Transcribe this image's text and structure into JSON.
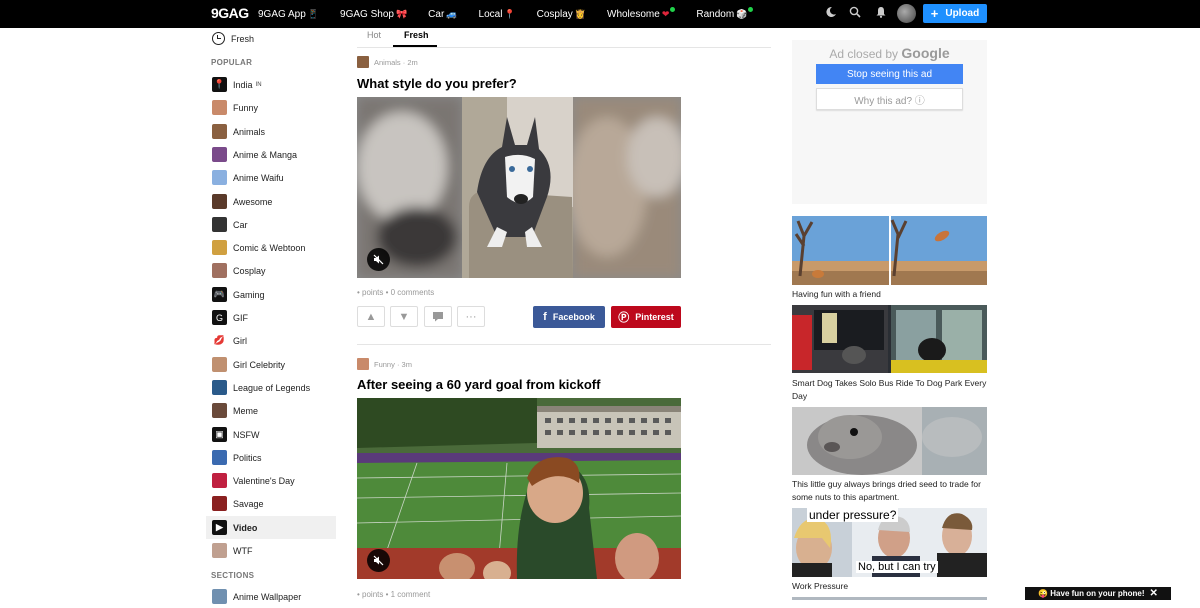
{
  "topbar": {
    "logo": "9GAG",
    "nav": [
      {
        "label": "9GAG App",
        "emoji": "📱",
        "dot": false
      },
      {
        "label": "9GAG Shop",
        "emoji": "🎀",
        "dot": false
      },
      {
        "label": "Car",
        "emoji": "🚙",
        "dot": false
      },
      {
        "label": "Local",
        "emoji": "📍",
        "dot": false
      },
      {
        "label": "Cosplay",
        "emoji": "👸",
        "dot": false
      },
      {
        "label": "Wholesome",
        "emoji": "❤",
        "dot": true
      },
      {
        "label": "Random",
        "emoji": "🎲",
        "dot": true
      }
    ],
    "upload_label": "Upload"
  },
  "sidebar": {
    "fresh_label": "Fresh",
    "popular_header": "POPULAR",
    "sections_header": "SECTIONS",
    "india_tag": "IN",
    "items": [
      {
        "label": "India",
        "color": "#111111",
        "glyph": "📍"
      },
      {
        "label": "Funny",
        "color": "#c98a6a",
        "glyph": ""
      },
      {
        "label": "Animals",
        "color": "#8a6040",
        "glyph": ""
      },
      {
        "label": "Anime & Manga",
        "color": "#7a4a8a",
        "glyph": ""
      },
      {
        "label": "Anime Waifu",
        "color": "#8ab0e0",
        "glyph": ""
      },
      {
        "label": "Awesome",
        "color": "#5a3a2a",
        "glyph": ""
      },
      {
        "label": "Car",
        "color": "#333333",
        "glyph": ""
      },
      {
        "label": "Comic & Webtoon",
        "color": "#d0a040",
        "glyph": ""
      },
      {
        "label": "Cosplay",
        "color": "#a07060",
        "glyph": ""
      },
      {
        "label": "Gaming",
        "color": "#111111",
        "glyph": "🎮"
      },
      {
        "label": "GIF",
        "color": "#111111",
        "glyph": "G"
      },
      {
        "label": "Girl",
        "color": "#ffffff",
        "glyph": "💋"
      },
      {
        "label": "Girl Celebrity",
        "color": "#c09070",
        "glyph": ""
      },
      {
        "label": "League of Legends",
        "color": "#2a5a8a",
        "glyph": ""
      },
      {
        "label": "Meme",
        "color": "#6a4a3a",
        "glyph": ""
      },
      {
        "label": "NSFW",
        "color": "#111111",
        "glyph": "▣"
      },
      {
        "label": "Politics",
        "color": "#3a6ab0",
        "glyph": ""
      },
      {
        "label": "Valentine's Day",
        "color": "#c02040",
        "glyph": ""
      },
      {
        "label": "Savage",
        "color": "#8a2020",
        "glyph": ""
      },
      {
        "label": "Video",
        "color": "#111111",
        "glyph": "▶"
      },
      {
        "label": "WTF",
        "color": "#c0a090",
        "glyph": ""
      }
    ],
    "sections_first": "Anime Wallpaper"
  },
  "feed": {
    "tabs": [
      "Hot",
      "Fresh"
    ],
    "active_tab": "Fresh",
    "posts": [
      {
        "section": "Animals",
        "age": "2m",
        "title": "What style do you prefer?",
        "stats": "• points • 0 comments"
      },
      {
        "section": "Funny",
        "age": "3m",
        "title": "After seeing a 60 yard goal from kickoff",
        "stats": "• points • 1 comment"
      }
    ],
    "facebook_label": "Facebook",
    "pinterest_label": "Pinterest",
    "colors": {
      "facebook": "#3b5998",
      "pinterest": "#bd081c"
    }
  },
  "ad": {
    "closed_prefix": "Ad closed by",
    "closed_brand": "Google",
    "stop_label": "Stop seeing this ad",
    "why_label": "Why this ad? ⓘ"
  },
  "suggested": [
    {
      "caption": "Having fun with a friend"
    },
    {
      "caption": "Smart Dog Takes Solo Bus Ride To Dog Park Every Day"
    },
    {
      "caption": "This little guy always brings dried seed to trade for some nuts to this apartment."
    },
    {
      "caption": "Work Pressure",
      "meme_top": "under pressure?",
      "meme_bottom": "No, but I can try"
    }
  ],
  "phone_bar": {
    "label": "😜 Have fun on your phone!",
    "close": "✕"
  }
}
